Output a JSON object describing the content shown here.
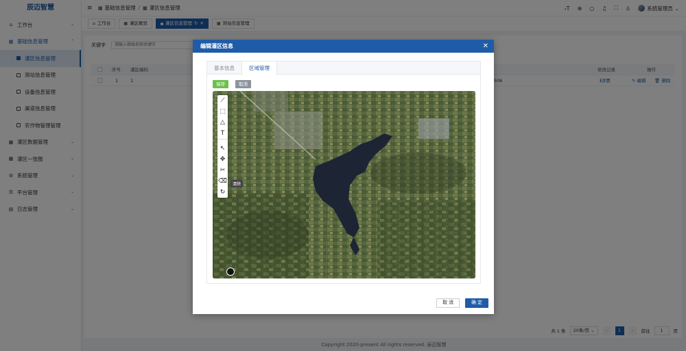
{
  "sidebar": {
    "logo": "辰迈智慧",
    "menu": [
      {
        "label": "工作台",
        "icon": "home-icon"
      },
      {
        "label": "基础信息管理",
        "icon": "grid-icon",
        "open": true
      },
      {
        "label": "灌区数据管理",
        "icon": "grid-icon"
      },
      {
        "label": "灌区一张图",
        "icon": "grid-icon"
      },
      {
        "label": "系统管理",
        "icon": "gear-icon"
      },
      {
        "label": "平台管理",
        "icon": "sliders-icon"
      },
      {
        "label": "日志管理",
        "icon": "doc-icon"
      }
    ],
    "submenu": [
      {
        "label": "灌区信息管理",
        "active": true
      },
      {
        "label": "测站信息管理"
      },
      {
        "label": "设备信息管理"
      },
      {
        "label": "渠道信息管理"
      },
      {
        "label": "农作物管理管理"
      }
    ]
  },
  "header": {
    "breadcrumb": [
      "基础信息管理",
      "灌区信息管理"
    ],
    "user": "系统管理员"
  },
  "tabs": [
    "工作台",
    "灌区概览",
    "灌区信息管理",
    "测站信息管理"
  ],
  "main": {
    "search_label": "关键字",
    "search_placeholder": "请输入梯级名称关键字",
    "columns": {
      "index": "序号",
      "code": "灌区编码",
      "record": "修改记录",
      "action": "操作"
    },
    "row": {
      "index": "1",
      "code": "1",
      "value": "506",
      "detail": "详情",
      "edit": "编辑",
      "delete": "删除"
    },
    "pager": {
      "total": "共 1 条",
      "size": "20条/页",
      "page": "1",
      "goto": "前往",
      "goto_value": "1",
      "page_unit": "页"
    }
  },
  "footer": "Copyright 2020-present All rights reserved. 辰迈智慧",
  "dialog": {
    "title": "编辑灌区信息",
    "tabs": [
      "基本信息",
      "区域管理"
    ],
    "save": "保存",
    "cancel_small": "取消",
    "tooltip": "清除",
    "cancel": "取 消",
    "confirm": "确 定"
  }
}
